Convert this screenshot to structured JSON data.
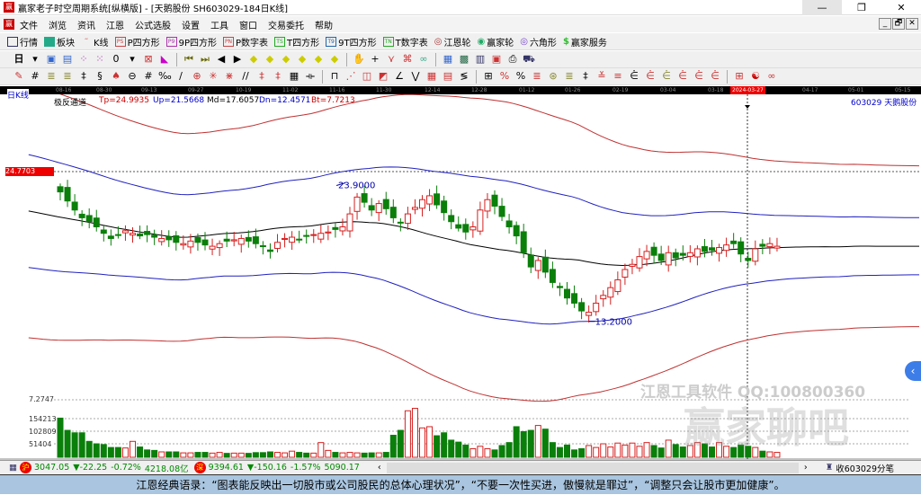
{
  "window": {
    "title": "赢家老子时空周期系统[纵横版] - [天鹅股份  SH603029-184日K线]",
    "min": "—",
    "max": "❐",
    "close": "✕"
  },
  "menu": [
    "文件",
    "浏览",
    "资讯",
    "江恩",
    "公式选股",
    "设置",
    "工具",
    "窗口",
    "交易委托",
    "帮助"
  ],
  "mdi": [
    "_",
    "🗗",
    "✕"
  ],
  "toolbar1": [
    {
      "icon": "grid-icon",
      "label": "行情"
    },
    {
      "icon": "blocks-icon",
      "label": "板块"
    },
    {
      "icon": "kline-icon",
      "label": "K线"
    },
    {
      "icon": "PS",
      "label": "P四方形"
    },
    {
      "icon": "P9",
      "label": "9P四方形"
    },
    {
      "icon": "PN",
      "label": "P数字表"
    },
    {
      "icon": "TS",
      "label": "T四方形"
    },
    {
      "icon": "T9",
      "label": "9T四方形"
    },
    {
      "icon": "TN",
      "label": "T数字表"
    },
    {
      "icon": "target-icon",
      "label": "江恩轮"
    },
    {
      "icon": "wheel-icon",
      "label": "赢家轮"
    },
    {
      "icon": "hexagon-icon",
      "label": "六角形"
    },
    {
      "icon": "dollar-icon",
      "label": "赢家服务"
    }
  ],
  "period": "日",
  "counter": "0",
  "dates": [
    "08-16",
    "08-30",
    "09-13",
    "09-27",
    "10-19",
    "11-02",
    "11-16",
    "11-30",
    "12-14",
    "12-28",
    "01-12",
    "01-26",
    "02-19",
    "03-04",
    "03-18",
    "2024-03-27",
    "04-17",
    "05-01",
    "05-15"
  ],
  "chart_type": "日K线",
  "indicator": {
    "name": "极反通道",
    "tp": "Tp=24.9935",
    "up": "Up=21.5668",
    "md": "Md=17.6057",
    "dn": "Dn=12.4571",
    "bt": "Bt=7.7213"
  },
  "stock": "603029 天鹅股份",
  "price_tag": "24.7703",
  "annotations": {
    "high": "23.9000",
    "low": "13.2000"
  },
  "volume_labels": [
    "7.2747",
    "154213",
    "102809",
    "51404"
  ],
  "colors": {
    "up": "#d62020",
    "down": "#0a7f0a",
    "md": "#000000",
    "band": "#2020c0",
    "outer": "#c03030"
  },
  "chart_data": {
    "type": "candlestick",
    "close": [
      23.2,
      22.5,
      21.8,
      21.2,
      20.9,
      20.5,
      20.0,
      19.6,
      19.9,
      20.2,
      20.0,
      19.8,
      19.9,
      19.7,
      19.6,
      19.5,
      19.3,
      19.2,
      19.4,
      19.3,
      19.1,
      19.0,
      19.2,
      19.4,
      19.5,
      19.6,
      19.4,
      19.2,
      19.0,
      18.6,
      19.3,
      19.6,
      19.7,
      19.5,
      19.8,
      19.9,
      20.0,
      20.1,
      20.3,
      20.5,
      21.5,
      22.8,
      22.4,
      21.8,
      22.3,
      21.9,
      21.2,
      20.8,
      21.5,
      22.0,
      22.6,
      22.9,
      22.2,
      21.6,
      20.9,
      20.4,
      20.1,
      20.5,
      21.8,
      22.6,
      22.1,
      21.3,
      20.5,
      19.8,
      18.5,
      17.4,
      17.9,
      17.0,
      16.2,
      15.8,
      15.0,
      14.6,
      14.0,
      13.9,
      14.6,
      15.2,
      15.8,
      16.4,
      17.2,
      17.6,
      18.2,
      18.6,
      18.3,
      17.9,
      18.5,
      18.1,
      18.3,
      18.5,
      18.8,
      18.6,
      18.7,
      18.9,
      19.1,
      19.2,
      18.4,
      17.9,
      18.8,
      19.0,
      19.2,
      19.0
    ],
    "volume": [
      160000,
      110000,
      100000,
      100000,
      65000,
      55000,
      52000,
      40000,
      40000,
      38000,
      65000,
      42000,
      30000,
      28000,
      22000,
      22000,
      22000,
      18000,
      18000,
      20000,
      20000,
      17000,
      20000,
      16000,
      17000,
      17000,
      16000,
      19000,
      19000,
      22000,
      20000,
      18000,
      25000,
      20000,
      17000,
      17000,
      60000,
      28000,
      20000,
      18000,
      20000,
      18000,
      17000,
      18000,
      18000,
      20000,
      90000,
      110000,
      190000,
      200000,
      120000,
      125000,
      88000,
      100000,
      70000,
      62000,
      50000,
      35000,
      45000,
      35000,
      30000,
      48000,
      60000,
      125000,
      105000,
      110000,
      130000,
      115000,
      60000,
      40000,
      50000,
      30000,
      35000,
      48000,
      40000,
      55000,
      42000,
      58000,
      50000,
      58000,
      45000,
      60000,
      48000,
      38000,
      70000,
      52000,
      42000,
      48000,
      60000,
      55000,
      42000,
      60000,
      45000,
      40000,
      50000,
      45000,
      40000,
      25000,
      22000,
      20000
    ],
    "ylim": [
      7.0,
      30.0
    ],
    "high_label": 23.9,
    "low_label": 13.2,
    "ref_price": 24.7703
  },
  "status": {
    "sh": "3047.05",
    "sh_chg": "▼-22.25",
    "sh_pct": "-0.72%",
    "sh_amt": "4218.08亿",
    "sz": "9394.61",
    "sz_chg": "▼-150.16",
    "sz_pct": "-1.57%",
    "sz_amt": "5090.17",
    "tick": "收603029分笔",
    "sh_badge": "沪",
    "sz_badge": "深"
  },
  "watermark": {
    "line1": "江恩工具软件  QQ:100800360",
    "line2": "赢家聊吧"
  },
  "quote": "江恩经典语录：“图表能反映出一切股市或公司股民的总体心理状况”，“不要一次性买进，傲慢就是罪过”，“调整只会让股市更加健康”。"
}
